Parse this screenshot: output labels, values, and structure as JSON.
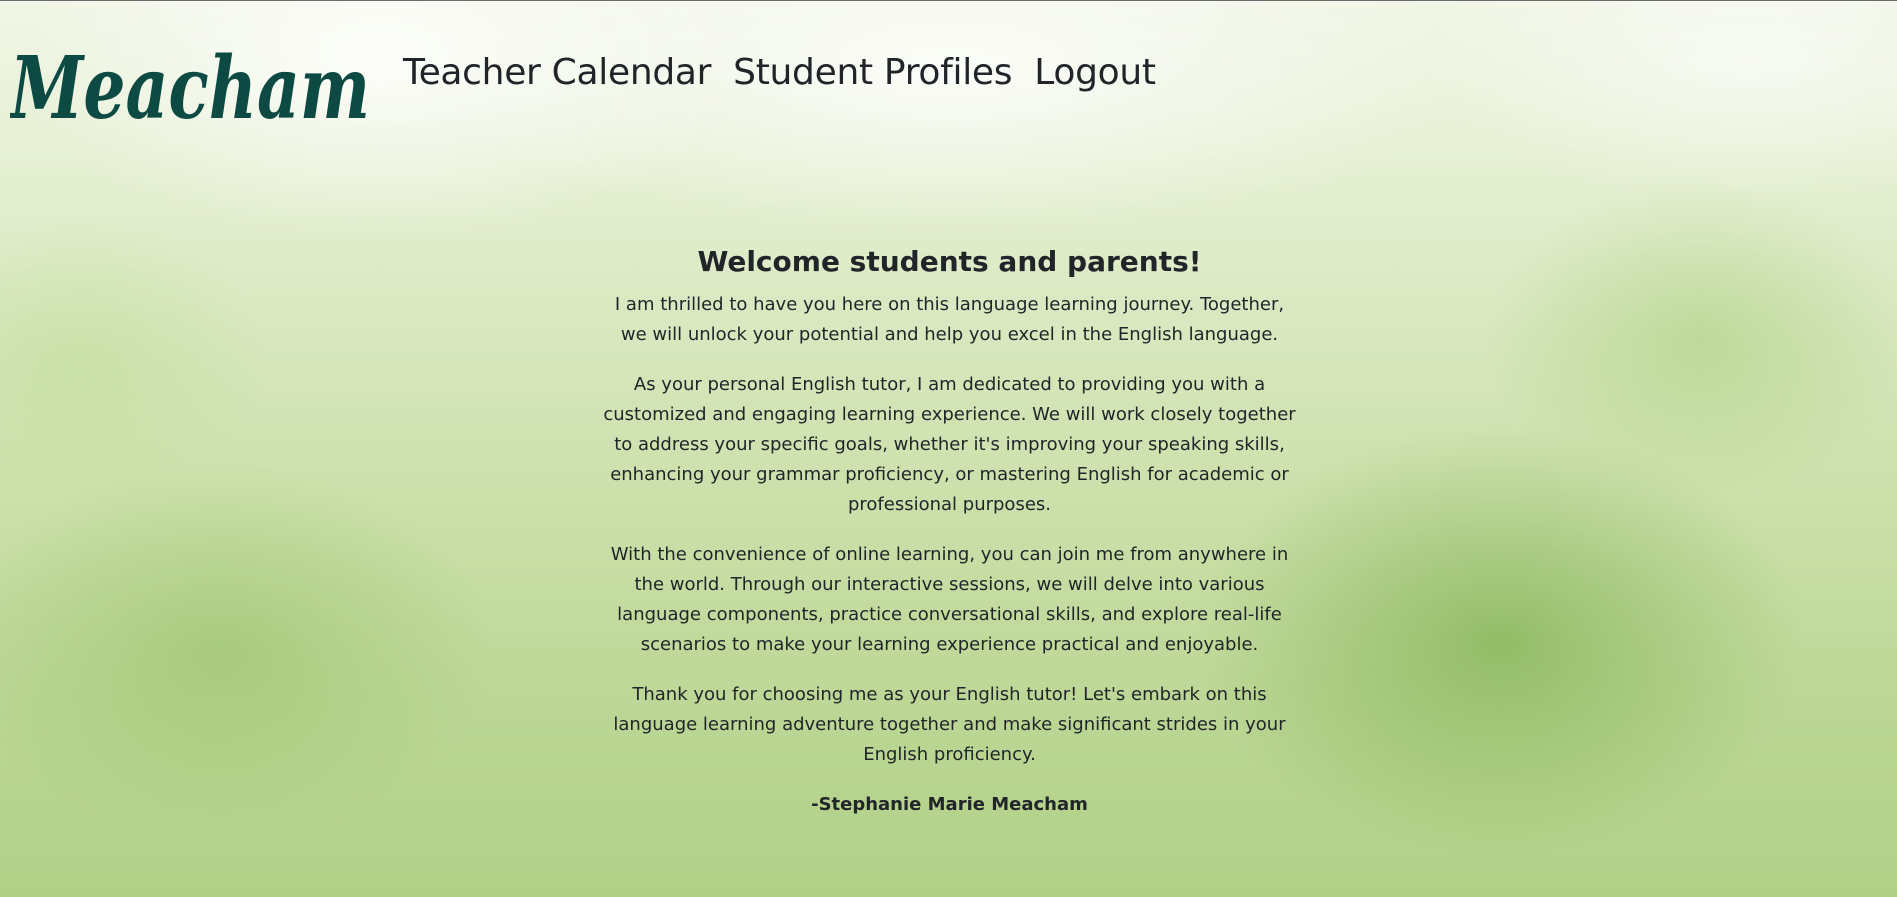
{
  "brand": {
    "logo_text": "Meacham"
  },
  "nav": {
    "items": [
      {
        "label": "Teacher Calendar"
      },
      {
        "label": "Student Profiles"
      },
      {
        "label": "Logout"
      }
    ]
  },
  "main": {
    "heading": "Welcome students and parents!",
    "paragraphs": [
      "I am thrilled to have you here on this language learning journey. Together, we will unlock your potential and help you excel in the English language.",
      "As your personal English tutor, I am dedicated to providing you with a customized and engaging learning experience. We will work closely together to address your specific goals, whether it's improving your speaking skills, enhancing your grammar proficiency, or mastering English for academic or professional purposes.",
      "With the convenience of online learning, you can join me from anywhere in the world. Through our interactive sessions, we will delve into various language components, practice conversational skills, and explore real-life scenarios to make your learning experience practical and enjoyable.",
      "Thank you for choosing me as your English tutor! Let's embark on this language learning adventure together and make significant strides in your English proficiency."
    ],
    "signature": "-Stephanie Marie Meacham"
  },
  "colors": {
    "logo": "#0d4a44",
    "text": "#212529",
    "background_light": "#f1f6e6",
    "background_green": "#b1d087"
  }
}
